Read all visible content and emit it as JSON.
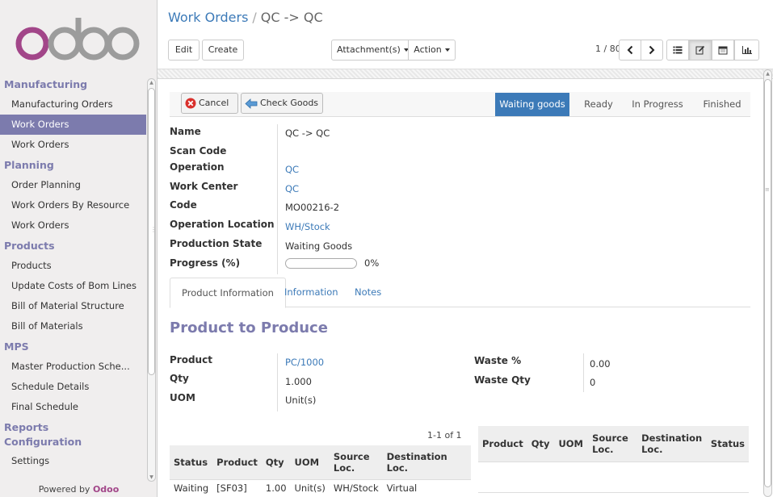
{
  "sidebar": {
    "sections": [
      {
        "label": "Manufacturing",
        "items": [
          {
            "label": "Manufacturing Orders",
            "active": false
          },
          {
            "label": "Work Orders",
            "active": true
          },
          {
            "label": "Work Orders",
            "active": false
          }
        ]
      },
      {
        "label": "Planning",
        "items": [
          {
            "label": "Order Planning",
            "active": false
          },
          {
            "label": "Work Orders By Resource",
            "active": false
          },
          {
            "label": "Work Orders",
            "active": false
          }
        ]
      },
      {
        "label": "Products",
        "items": [
          {
            "label": "Products",
            "active": false
          },
          {
            "label": "Update Costs of Bom Lines",
            "active": false
          },
          {
            "label": "Bill of Material Structure",
            "active": false
          },
          {
            "label": "Bill of Materials",
            "active": false
          }
        ]
      },
      {
        "label": "MPS",
        "items": [
          {
            "label": "Master Production Sche...",
            "active": false
          },
          {
            "label": "Schedule Details",
            "active": false
          },
          {
            "label": "Final Schedule",
            "active": false
          }
        ]
      },
      {
        "label": "Reports",
        "items": []
      },
      {
        "label": "Configuration",
        "items": [
          {
            "label": "Settings",
            "active": false
          }
        ]
      }
    ],
    "powered_prefix": "Powered by",
    "powered_brand": "Odoo"
  },
  "breadcrumb": {
    "parent": "Work Orders",
    "separator": "/",
    "current": "QC -> QC"
  },
  "toolbar": {
    "edit_label": "Edit",
    "create_label": "Create",
    "attachments_label": "Attachment(s)",
    "action_label": "Action",
    "pager": "1 / 80"
  },
  "statusbar": {
    "cancel_label": "Cancel",
    "check_goods_label": "Check Goods",
    "stages": [
      "Waiting goods",
      "Ready",
      "In Progress",
      "Finished"
    ],
    "active_stage": 0
  },
  "fields": {
    "name": {
      "label": "Name",
      "value": "QC -> QC"
    },
    "scan_code": {
      "label": "Scan Code",
      "value": ""
    },
    "operation": {
      "label": "Operation",
      "value": "QC"
    },
    "work_center": {
      "label": "Work Center",
      "value": "QC"
    },
    "code": {
      "label": "Code",
      "value": "MO00216-2"
    },
    "operation_location": {
      "label": "Operation Location",
      "value": "WH/Stock"
    },
    "production_state": {
      "label": "Production State",
      "value": "Waiting Goods"
    },
    "progress": {
      "label": "Progress (%)",
      "value": 0,
      "display": "0%"
    }
  },
  "tabs": [
    "Product Information",
    "Information",
    "Notes"
  ],
  "product_section": {
    "title": "Product to Produce",
    "product": {
      "label": "Product",
      "value": "PC/1000"
    },
    "qty": {
      "label": "Qty",
      "value": "1.000"
    },
    "uom": {
      "label": "UOM",
      "value": "Unit(s)"
    },
    "waste_pct": {
      "label": "Waste %",
      "value": "0.00"
    },
    "waste_qty": {
      "label": "Waste Qty",
      "value": "0"
    }
  },
  "moves_table": {
    "pager": "1-1 of 1",
    "headers": [
      "Status",
      "Product",
      "Qty",
      "UOM",
      "Source Loc.",
      "Destination Loc."
    ],
    "rows": [
      [
        "Waiting",
        "[SF03]",
        "1.00",
        "Unit(s)",
        "WH/Stock",
        "Virtual"
      ]
    ]
  },
  "finished_table": {
    "headers": [
      "Product",
      "Qty",
      "UOM",
      "Source Loc.",
      "Destination Loc.",
      "Status"
    ]
  },
  "colors": {
    "accent": "#7c7bad",
    "link": "#3c7ab8",
    "brand": "#a24689"
  }
}
